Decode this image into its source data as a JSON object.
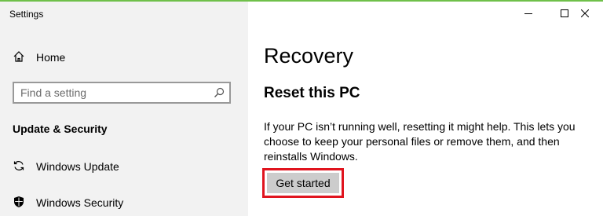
{
  "window": {
    "app_title": "Settings",
    "accent_color": "#6fc04a",
    "controls": [
      "minimize-icon",
      "maximize-icon",
      "close-icon"
    ]
  },
  "sidebar": {
    "home": {
      "label": "Home",
      "icon": "home-icon"
    },
    "search": {
      "placeholder": "Find a setting",
      "value": "",
      "icon": "search-icon"
    },
    "section_heading": "Update & Security",
    "items": [
      {
        "label": "Windows Update",
        "icon": "sync-icon"
      },
      {
        "label": "Windows Security",
        "icon": "shield-icon"
      }
    ]
  },
  "main": {
    "page_title": "Recovery",
    "section_title": "Reset this PC",
    "description": "If your PC isn’t running well, resetting it might help. This lets you choose to keep your personal files or remove them, and then reinstalls Windows.",
    "primary_button": "Get started",
    "highlight_color": "#e0141e"
  }
}
